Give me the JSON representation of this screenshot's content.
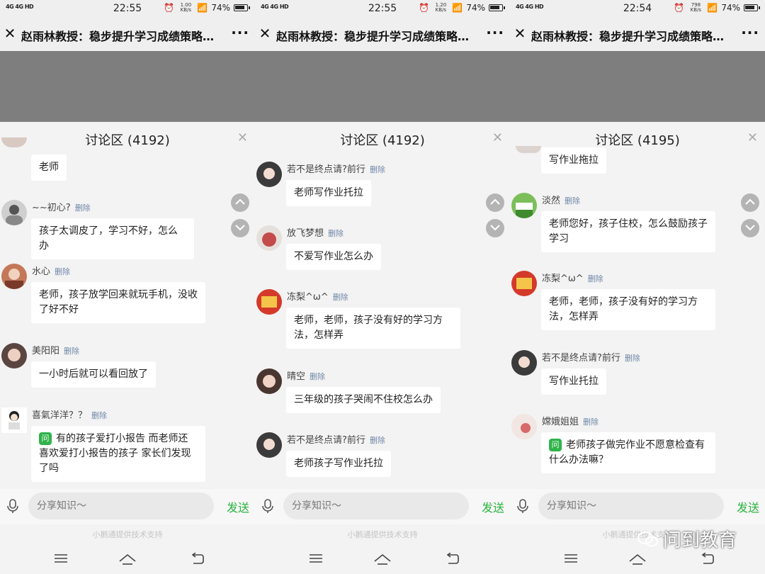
{
  "status_bar": {
    "network": "4G 4G HD",
    "speeds": [
      "1.00 KB/s",
      "1.20 KB/s",
      "798 KB/s"
    ],
    "times": [
      "22:55",
      "22:55",
      "22:54"
    ],
    "battery": "74%"
  },
  "page_title": "赵雨林教授：稳步提升学习成绩策略…",
  "panels": [
    {
      "discussion_title": "讨论区 (4192)"
    },
    {
      "discussion_title": "讨论区 (4192)"
    },
    {
      "discussion_title": "讨论区 (4195)"
    }
  ],
  "delete_label": "删除",
  "messages": {
    "p0": [
      {
        "user": "",
        "text": "老师"
      },
      {
        "user": "~~初心?",
        "text": "孩子太调皮了，学习不好，怎么办"
      },
      {
        "user": "水心",
        "text": "老师，孩子放学回来就玩手机，没收了好不好"
      },
      {
        "user": "美阳阳",
        "text": "一小时后就可以看回放了"
      },
      {
        "user": "喜氣洋洋？？",
        "text": "有的孩子爱打小报告 而老师还喜欢爱打小报告的孩子 家长们发现了吗"
      }
    ],
    "p1": [
      {
        "user": "若不是终点请?前行",
        "text": "老师写作业托拉"
      },
      {
        "user": "放飞梦想",
        "text": "不爱写作业怎么办"
      },
      {
        "user": "冻梨^ω^",
        "text": "老师，老师，孩子没有好的学习方法，怎样弄"
      },
      {
        "user": "晴空",
        "text": "三年级的孩子哭闹不住校怎么办"
      },
      {
        "user": "若不是终点请?前行",
        "text": "老师孩子写作业托拉"
      }
    ],
    "p2": [
      {
        "user": "",
        "text": "写作业拖拉"
      },
      {
        "user": "淡然",
        "text": "老师您好，孩子住校，怎么鼓励孩子学习"
      },
      {
        "user": "冻梨^ω^",
        "text": "老师，老师，孩子没有好的学习方法，怎样弄"
      },
      {
        "user": "若不是终点请?前行",
        "text": "写作业托拉"
      },
      {
        "user": "嫦娥姐姐",
        "text": "老师孩子做完作业不愿意检查有什么办法嘛？"
      }
    ]
  },
  "question_badge": "问",
  "input": {
    "placeholder": "分享知识～",
    "send_label": "发送"
  },
  "support_text": "小鹅通提供技术支持",
  "watermark": "问到教育",
  "colors": {
    "accent_green": "#27b33c",
    "video_bg": "#7e7e7e",
    "delete_blue": "#6f87a8"
  }
}
